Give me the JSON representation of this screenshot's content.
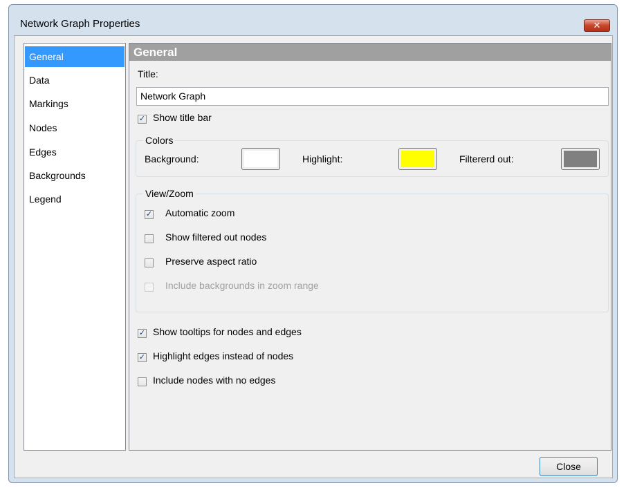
{
  "window": {
    "title": "Network Graph Properties",
    "close_glyph": "✕"
  },
  "sidebar": {
    "items": [
      {
        "label": "General",
        "selected": true
      },
      {
        "label": "Data"
      },
      {
        "label": "Markings"
      },
      {
        "label": "Nodes"
      },
      {
        "label": "Edges"
      },
      {
        "label": "Backgrounds"
      },
      {
        "label": "Legend"
      }
    ]
  },
  "panel": {
    "header": "General",
    "title_label": "Title:",
    "title_value": "Network Graph",
    "show_title_bar": {
      "label": "Show title bar",
      "checked": true
    },
    "colors": {
      "legend": "Colors",
      "background": {
        "label": "Background:",
        "color": "#ffffff"
      },
      "highlight": {
        "label": "Highlight:",
        "color": "#ffff00"
      },
      "filtered_out": {
        "label": "Filtererd out:",
        "color": "#808080"
      }
    },
    "view_zoom": {
      "legend": "View/Zoom",
      "automatic_zoom": {
        "label": "Automatic zoom",
        "checked": true
      },
      "show_filtered_out_nodes": {
        "label": "Show filtered out nodes",
        "checked": false
      },
      "preserve_aspect_ratio": {
        "label": "Preserve aspect ratio",
        "checked": false
      },
      "include_backgrounds": {
        "label": "Include backgrounds in zoom range",
        "checked": false,
        "disabled": true
      }
    },
    "show_tooltips": {
      "label": "Show tooltips for nodes and edges",
      "checked": true
    },
    "highlight_edges": {
      "label": "Highlight edges instead of nodes",
      "checked": true
    },
    "include_no_edges": {
      "label": "Include nodes with no edges",
      "checked": false
    }
  },
  "footer": {
    "close_label": "Close"
  },
  "check_glyph": "✓"
}
